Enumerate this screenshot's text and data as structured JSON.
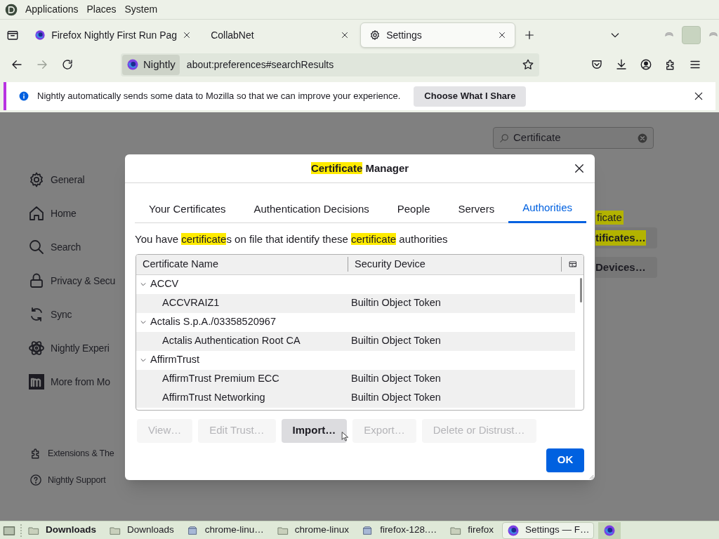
{
  "top_panel": {
    "menus": [
      "Applications",
      "Places",
      "System"
    ]
  },
  "tabs": [
    {
      "title": "Firefox Nightly First Run Pag",
      "kind": "firefox",
      "selected": false
    },
    {
      "title": "CollabNet",
      "kind": "none",
      "selected": false
    },
    {
      "title": "Settings",
      "kind": "gear",
      "selected": true
    }
  ],
  "nav": {
    "identity": "Nightly",
    "url": "about:preferences#searchResults"
  },
  "notification": {
    "message": "Nightly automatically sends some data to Mozilla so that we can improve your experience.",
    "button": "Choose What I Share"
  },
  "settings": {
    "search": {
      "value": "Certificate"
    },
    "sidebar": [
      {
        "label": "General",
        "kind": "gear"
      },
      {
        "label": "Home",
        "kind": "home"
      },
      {
        "label": "Search",
        "kind": "search"
      },
      {
        "label": "Privacy & Secu",
        "kind": "lock"
      },
      {
        "label": "Sync",
        "kind": "sync"
      },
      {
        "label": "Nightly Experi",
        "kind": "atom"
      },
      {
        "label": "More from Mo",
        "kind": "m"
      }
    ],
    "footer": [
      {
        "label": "Extensions & The",
        "kind": "puzzle"
      },
      {
        "label": "Nightly Support",
        "kind": "help"
      }
    ],
    "behind": [
      {
        "text": "ficate",
        "kind": "highlight"
      },
      {
        "text": "tificates…",
        "kind": "highlight-button"
      },
      {
        "text": "Devices…",
        "kind": "button"
      }
    ]
  },
  "dialog": {
    "title": [
      {
        "text": "Certificate",
        "highlight": true
      },
      {
        "text": " Manager",
        "highlight": false
      }
    ],
    "tabs": [
      {
        "label": "Your Certificates",
        "selected": false
      },
      {
        "label": "Authentication Decisions",
        "selected": false
      },
      {
        "label": "People",
        "selected": false
      },
      {
        "label": "Servers",
        "selected": false
      },
      {
        "label": "Authorities",
        "selected": true
      }
    ],
    "description": [
      {
        "text": "You have ",
        "highlight": false
      },
      {
        "text": "certificate",
        "highlight": true
      },
      {
        "text": "s on file that identify these ",
        "highlight": false
      },
      {
        "text": "certificate",
        "highlight": true
      },
      {
        "text": " authorities",
        "highlight": false
      }
    ],
    "table": {
      "columns": [
        "Certificate Name",
        "Security Device"
      ],
      "rows": [
        {
          "name": "ACCV",
          "expanded": true,
          "children": [
            {
              "name": "ACCVRAIZ1",
              "device": "Builtin Object Token"
            }
          ]
        },
        {
          "name": "Actalis S.p.A./03358520967",
          "expanded": true,
          "children": [
            {
              "name": "Actalis Authentication Root CA",
              "device": "Builtin Object Token"
            }
          ]
        },
        {
          "name": "AffirmTrust",
          "expanded": true,
          "children": [
            {
              "name": "AffirmTrust Premium ECC",
              "device": "Builtin Object Token"
            },
            {
              "name": "AffirmTrust Networking",
              "device": "Builtin Object Token"
            }
          ]
        }
      ]
    },
    "buttons": [
      {
        "label": "View…",
        "disabled": true
      },
      {
        "label": "Edit Trust…",
        "disabled": true
      },
      {
        "label": "Import…",
        "disabled": false
      },
      {
        "label": "Export…",
        "disabled": true
      },
      {
        "label": "Delete or Distrust…",
        "disabled": true
      }
    ],
    "ok": "OK"
  },
  "taskbar": {
    "items": [
      {
        "label": "Downloads",
        "kind": "folder",
        "emphasized": true,
        "selected": false
      },
      {
        "label": "Downloads",
        "kind": "folder",
        "emphasized": false,
        "selected": false
      },
      {
        "label": "chrome-linu…",
        "kind": "package",
        "emphasized": false,
        "selected": false
      },
      {
        "label": "chrome-linux",
        "kind": "folder",
        "emphasized": false,
        "selected": false
      },
      {
        "label": "firefox-128.…",
        "kind": "package",
        "emphasized": false,
        "selected": false
      },
      {
        "label": "firefox",
        "kind": "folder",
        "emphasized": false,
        "selected": false
      },
      {
        "label": "Settings — F…",
        "kind": "firefox",
        "emphasized": false,
        "selected": true
      }
    ]
  }
}
